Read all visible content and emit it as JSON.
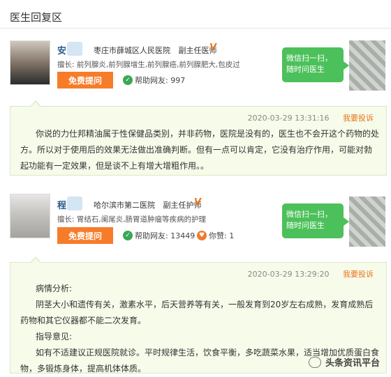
{
  "section_title": "医生回复区",
  "doctors": [
    {
      "name": "安",
      "hospital": "枣庄市薛城区人民医院",
      "title": "副主任医师",
      "verified": "V",
      "specialty": "擅长: 前列腺炎,前列腺增生,前列腺癌,前列腺肥大,包皮过",
      "ask_button": "免费提问",
      "help_label": "帮助网友: 997",
      "wechat": "微信扫一扫，随时问医生",
      "reply": {
        "time": "2020-03-29 13:31:16",
        "complain": "我要投诉",
        "paragraphs": [
          "你说的力仕邦精油属于性保健品类别，并非药物，医院是没有的，医生也不会开这个药物的处方。所以对于使用后的效果无法做出准确判断。但有一点可以肯定，它没有治疗作用，可能对勃起功能有一定效果，但是谈不上有增大增粗作用。。"
        ]
      }
    },
    {
      "name": "程",
      "hospital": "哈尔滨市第二医院",
      "title": "副主任护师",
      "verified": "V",
      "specialty": "擅长: 胃结石,阑尾炎,肠胃道肿瘤等疾病的护理",
      "ask_button": "免费提问",
      "help_label": "帮助网友: 13449",
      "like_label": "你赞: 1",
      "wechat": "微信扫一扫，随时问医生",
      "reply": {
        "time": "2020-03-29 13:29:20",
        "complain": "我要投诉",
        "analysis_title": "病情分析:",
        "analysis": "阴茎大小和遗传有关，激素水平，后天营养等有关，一般发育到20岁左右成熟，发育成熟后药物和其它仪器都不能二次发育。",
        "advice_title": "指导意见:",
        "advice": "如有不适建议正规医院就诊。平时规律生活，饮食平衡，多吃蔬菜水果，适当增加优质蛋白食物，多锻炼身体，提高机体体质。"
      }
    }
  ],
  "watermark": "头条资讯平台",
  "colors": {
    "accent": "#f77c2a",
    "green": "#4cc05a",
    "reply_bg": "#f7fbea",
    "name_blue": "#2a5d8f"
  }
}
